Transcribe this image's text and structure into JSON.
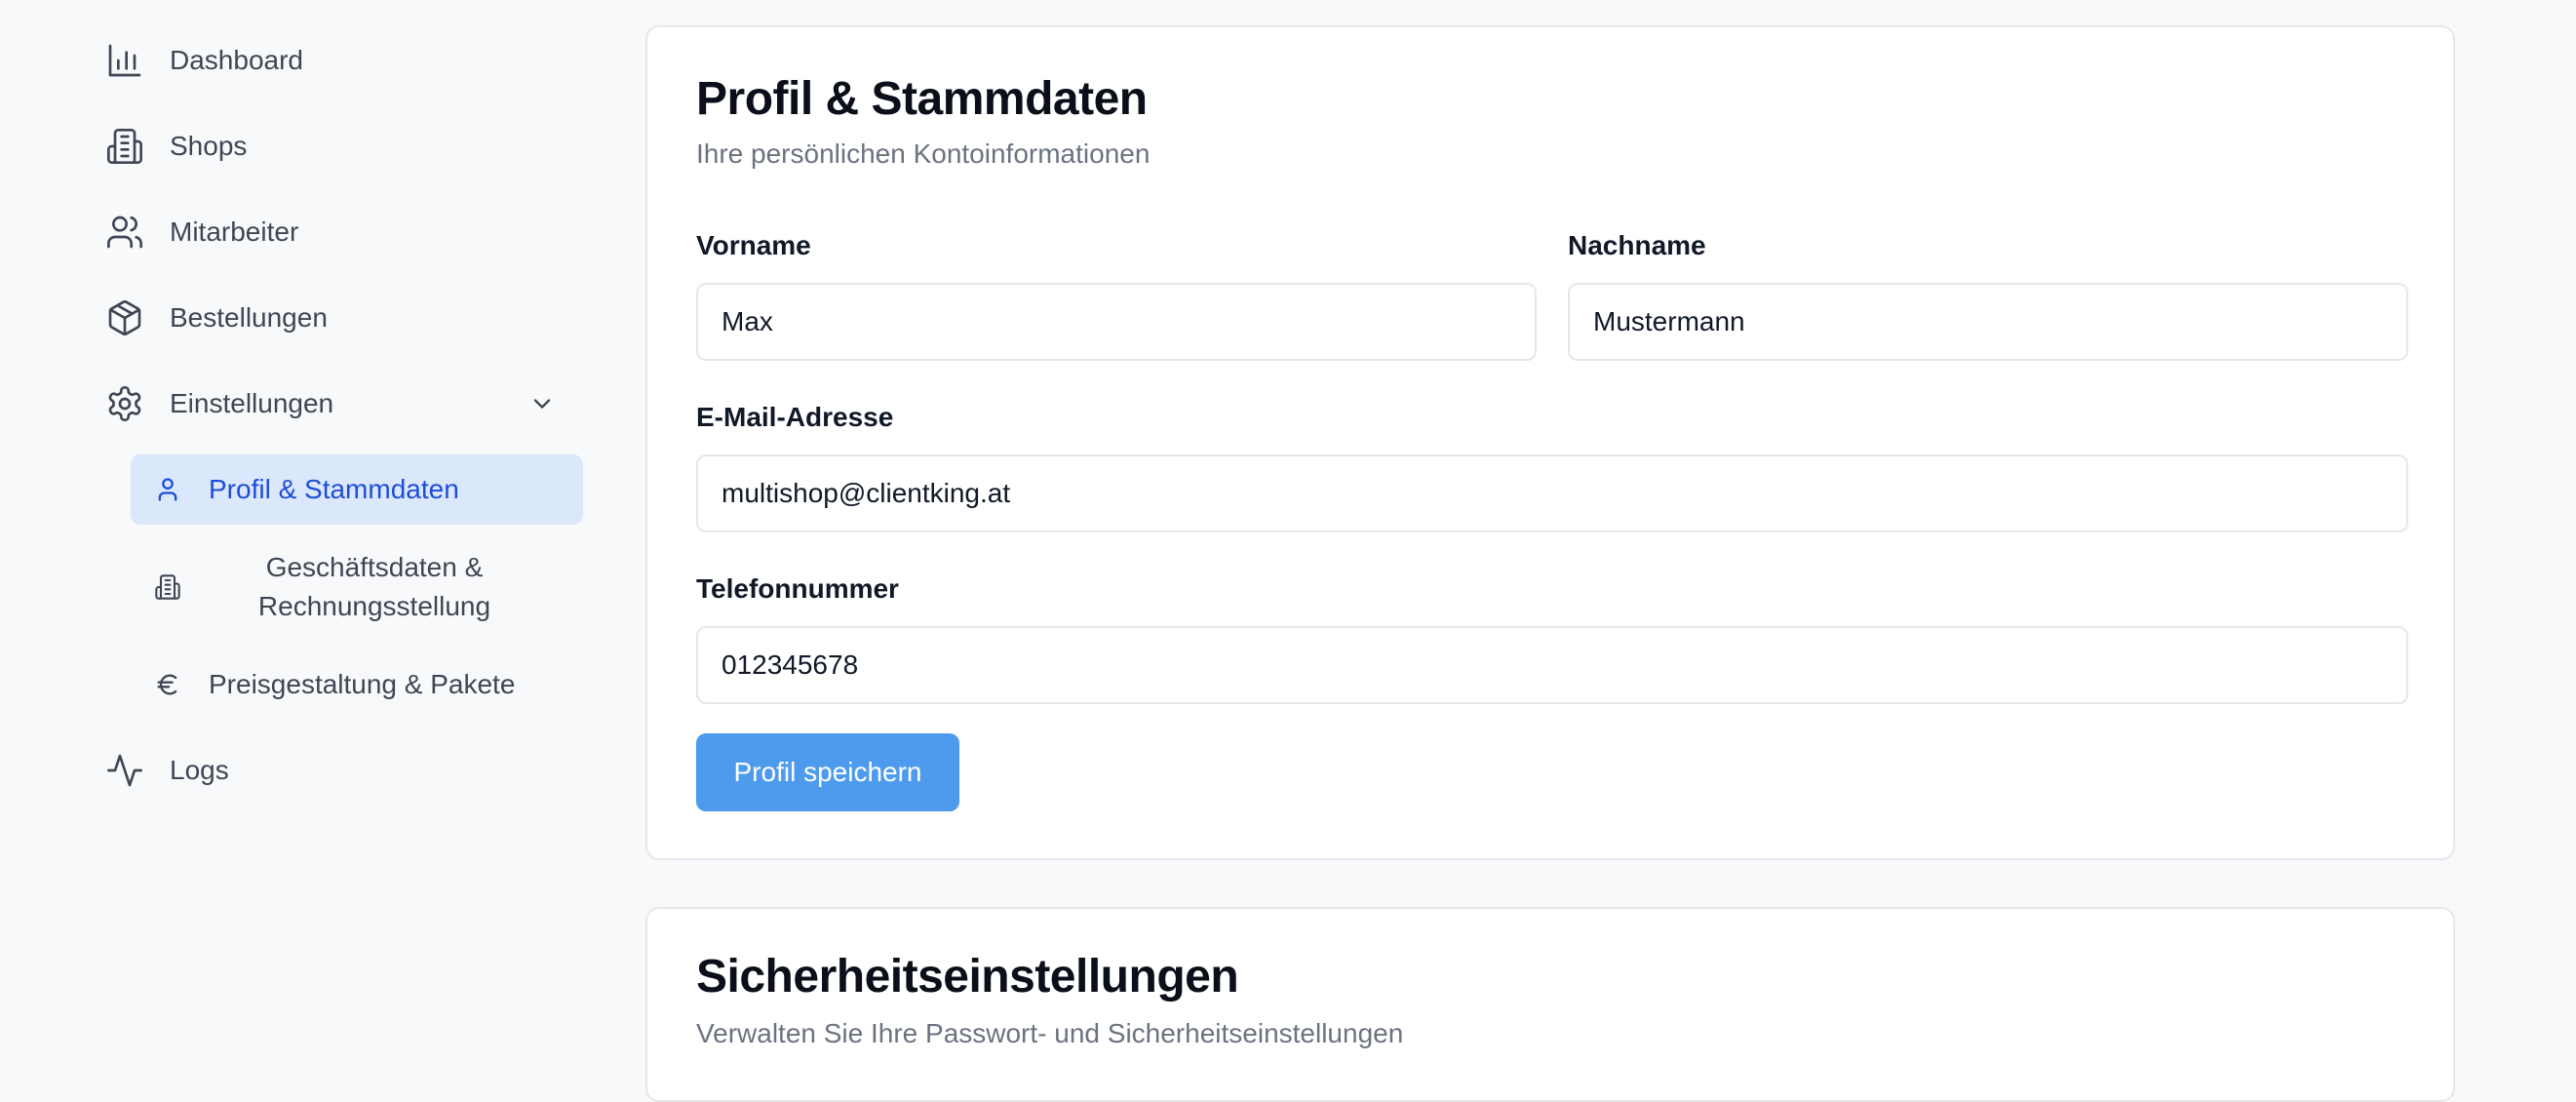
{
  "sidebar": {
    "items": [
      {
        "label": "Dashboard",
        "icon": "bar-chart-icon"
      },
      {
        "label": "Shops",
        "icon": "building-icon"
      },
      {
        "label": "Mitarbeiter",
        "icon": "users-icon"
      },
      {
        "label": "Bestellungen",
        "icon": "package-icon"
      },
      {
        "label": "Einstellungen",
        "icon": "gear-icon",
        "expanded": true
      },
      {
        "label": "Logs",
        "icon": "activity-icon"
      }
    ],
    "sub_items": [
      {
        "label": "Profil & Stammdaten",
        "icon": "user-icon",
        "active": true
      },
      {
        "label": "Geschäftsdaten & Rechnungsstellung",
        "icon": "building-icon"
      },
      {
        "label": "Preisgestaltung & Pakete",
        "icon": "euro-icon"
      }
    ],
    "active_color": "#1d4ed8",
    "active_bg": "#dbe8fb"
  },
  "profile_card": {
    "title": "Profil & Stammdaten",
    "subtitle": "Ihre persönlichen Kontoinformationen",
    "fields": {
      "first_name": {
        "label": "Vorname",
        "value": "Max"
      },
      "last_name": {
        "label": "Nachname",
        "value": "Mustermann"
      },
      "email": {
        "label": "E-Mail-Adresse",
        "value": "multishop@clientking.at"
      },
      "phone": {
        "label": "Telefonnummer",
        "value": "012345678"
      }
    },
    "save_label": "Profil speichern",
    "button_color": "#4e9bed"
  },
  "security_card": {
    "title": "Sicherheitseinstellungen",
    "subtitle": "Verwalten Sie Ihre Passwort- und Sicherheitseinstellungen"
  }
}
